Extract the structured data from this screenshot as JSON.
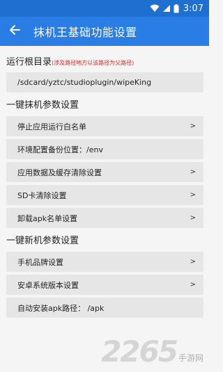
{
  "status_bar": {
    "time": "3:07"
  },
  "app_bar": {
    "title": "抹机王基础功能设置"
  },
  "sections": [
    {
      "title": "运行根目录",
      "note": "(涉及路径地方以该路径为父路径)",
      "rows": [
        {
          "label": "/sdcard/yztc/studioplugin/wipeKing",
          "arrow": ""
        }
      ]
    },
    {
      "title": "一键抹机参数设置",
      "note": "",
      "rows": [
        {
          "label": "停止应用运行白名单",
          "arrow": ">"
        },
        {
          "label": "环境配置备份位置：/env",
          "arrow": ""
        },
        {
          "label": "应用数据及缓存清除设置",
          "arrow": ">"
        },
        {
          "label": "SD卡清除设置",
          "arrow": ">"
        },
        {
          "label": "卸载apk名单设置",
          "arrow": ">"
        }
      ]
    },
    {
      "title": "一键新机参数设置",
      "note": "",
      "rows": [
        {
          "label": "手机品牌设置",
          "arrow": ">"
        },
        {
          "label": "安卓系统版本设置",
          "arrow": ">"
        },
        {
          "label": "自动安装apk路径： /apk",
          "arrow": ""
        }
      ]
    }
  ],
  "watermark": {
    "number": "2265",
    "text": "手游网"
  },
  "icons": [
    "wifi-icon",
    "cellular-signal-icon",
    "battery-icon",
    "back-arrow-icon"
  ],
  "colors": {
    "app_bar": "#2b7de6",
    "status_bar": "#1e6fd0",
    "note": "#e02828",
    "row_bg": "#e6e6e6"
  }
}
